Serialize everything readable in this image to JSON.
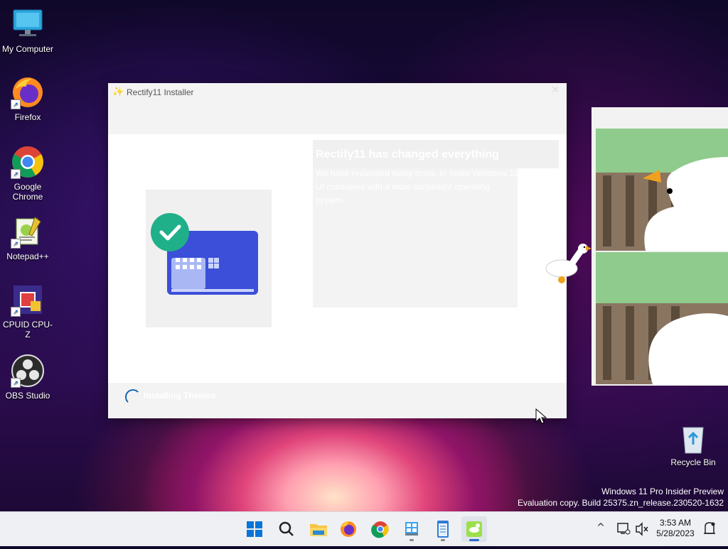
{
  "desktop": {
    "icons": [
      {
        "label": "My Computer",
        "icon": "monitor-icon"
      },
      {
        "label": "Firefox",
        "icon": "firefox-icon"
      },
      {
        "label": "Google Chrome",
        "icon": "chrome-icon"
      },
      {
        "label": "Notepad++",
        "icon": "notepadpp-icon"
      },
      {
        "label": "CPUID CPU-Z",
        "icon": "cpuz-icon"
      },
      {
        "label": "OBS Studio",
        "icon": "obs-icon"
      }
    ],
    "recycle_bin": "Recycle Bin",
    "watermark": {
      "line1": "Windows 11 Pro Insider Preview",
      "line2": "Evaluation copy. Build 25375.zn_release.230520-1632"
    }
  },
  "installer": {
    "title": "Rectify11 Installer",
    "close_glyph": "✕",
    "heading": "Rectify11 has changed everything",
    "description": "We have revamped many icons, to make Windows 11 UI consistent with a more consistent operating system.",
    "status": "Installing Themes",
    "accent": "#1066b8"
  },
  "taskbar": {
    "items": [
      "start-icon",
      "search-icon",
      "file-explorer-icon",
      "firefox-icon",
      "chrome-icon",
      "installer-icon",
      "notepad-icon",
      "desktop-goose-icon"
    ],
    "tray": {
      "chevron": "^",
      "time": "3:53 AM",
      "date": "5/28/2023"
    }
  }
}
